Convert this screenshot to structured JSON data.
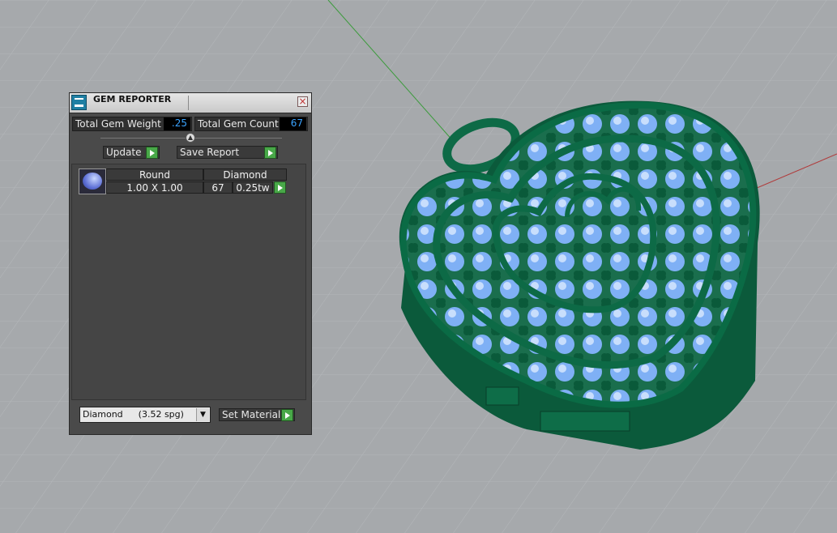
{
  "panel": {
    "title": "GEM REPORTER",
    "close_glyph": "×",
    "total_weight_label": "Total Gem Weight",
    "total_weight_value": ".25",
    "total_count_label": "Total Gem Count",
    "total_count_value": "67",
    "update_label": "Update",
    "save_report_label": "Save Report",
    "gems": [
      {
        "shape": "Round",
        "material": "Diamond",
        "size": "1.00 X 1.00",
        "count": "67",
        "weight": "0.25tw"
      }
    ],
    "material_select": {
      "name": "Diamond",
      "spg": "(3.52 spg)"
    },
    "set_material_label": "Set Material"
  },
  "icons": {
    "app": "gem-reporter-app-icon",
    "close": "close-icon",
    "go": "green-play-arrow-icon",
    "dropdown": "chevron-down-icon"
  },
  "colors": {
    "model_green": "#0f6f4a",
    "gem_blue": "#8ab4ff",
    "value_text": "#3aa3ff",
    "go_button": "#48a848"
  }
}
